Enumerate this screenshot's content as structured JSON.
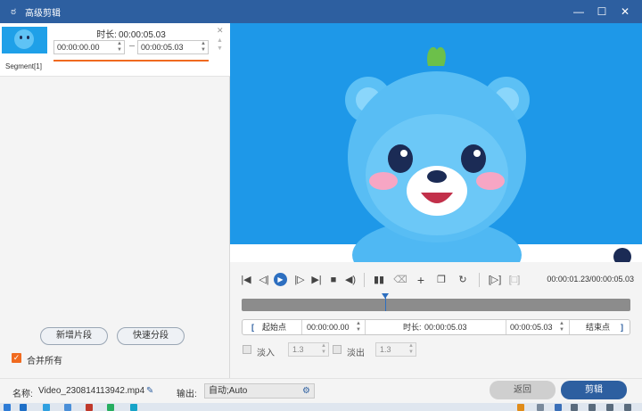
{
  "window": {
    "title": "高级剪辑",
    "logo_icon": "rabbit-logo-icon",
    "controls": {
      "minimize": "—",
      "maximize": "☐",
      "close": "✕"
    }
  },
  "segment": {
    "label": "Segment[1]",
    "duration_label": "时长:",
    "duration_value": "00:00:05.03",
    "start_time": "00:00:00.00",
    "end_time": "00:00:05.03",
    "close_icon": "close-icon"
  },
  "left_buttons": {
    "add_segment": "新增片段",
    "quick_split": "快速分段"
  },
  "merge_all": {
    "label": "合并所有",
    "checked": true
  },
  "player": {
    "timecode": "00:00:01.23/00:00:05.03",
    "progress_fraction": 0.37
  },
  "trim_bar": {
    "start_button": "起始点",
    "start_value": "00:00:00.00",
    "duration_label": "时长:",
    "duration_value": "00:00:05.03",
    "end_value": "00:00:05.03",
    "end_button": "结束点"
  },
  "fade": {
    "fade_in_label": "淡入",
    "fade_in_value": "1.3",
    "fade_out_label": "淡出",
    "fade_out_value": "1.3"
  },
  "footer": {
    "name_label": "名称:",
    "file_name": "Video_230814113942.mp4",
    "output_label": "输出:",
    "output_value": "自动;Auto",
    "back_button": "返回",
    "cut_button": "剪辑"
  },
  "colors": {
    "brand": "#2d5fa0",
    "accent": "#f06a1f",
    "video_bg": "#1e98e8"
  }
}
